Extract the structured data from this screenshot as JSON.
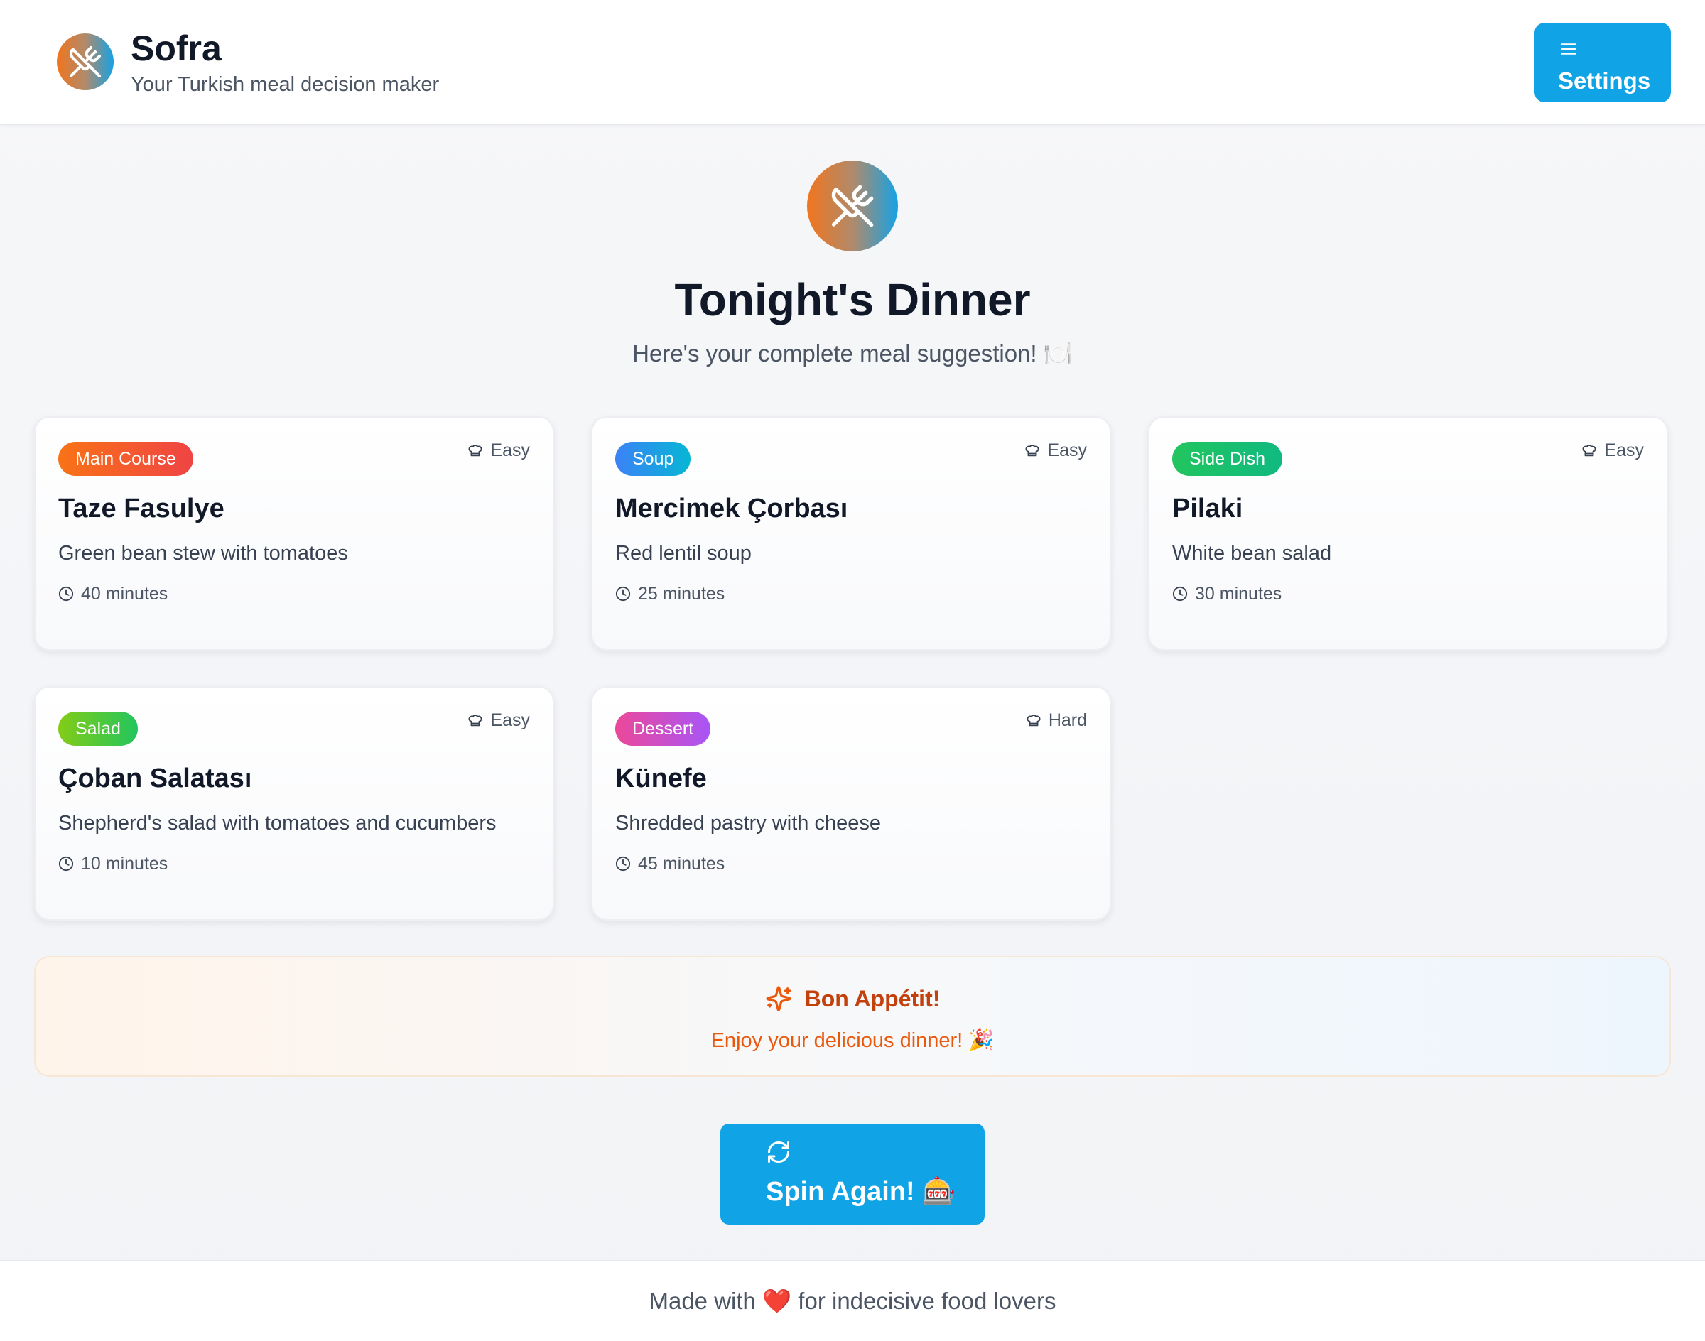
{
  "header": {
    "title": "Sofra",
    "subtitle": "Your Turkish meal decision maker",
    "settings_label": "Settings"
  },
  "hero": {
    "title": "Tonight's Dinner",
    "subtitle": "Here's your complete meal suggestion! 🍽️"
  },
  "meals": [
    {
      "category": "Main Course",
      "category_color": "linear-gradient(90deg,#f97316,#ef4444)",
      "difficulty": "Easy",
      "name": "Taze Fasulye",
      "description": "Green bean stew with tomatoes",
      "time": "40 minutes"
    },
    {
      "category": "Soup",
      "category_color": "linear-gradient(90deg,#3b82f6,#06b6d4)",
      "difficulty": "Easy",
      "name": "Mercimek Çorbası",
      "description": "Red lentil soup",
      "time": "25 minutes"
    },
    {
      "category": "Side Dish",
      "category_color": "linear-gradient(90deg,#22c55e,#10b981)",
      "difficulty": "Easy",
      "name": "Pilaki",
      "description": "White bean salad",
      "time": "30 minutes"
    },
    {
      "category": "Salad",
      "category_color": "linear-gradient(90deg,#84cc16,#22c55e)",
      "difficulty": "Easy",
      "name": "Çoban Salatası",
      "description": "Shepherd's salad with tomatoes and cucumbers",
      "time": "10 minutes"
    },
    {
      "category": "Dessert",
      "category_color": "linear-gradient(90deg,#ec4899,#a855f7)",
      "difficulty": "Hard",
      "name": "Künefe",
      "description": "Shredded pastry with cheese",
      "time": "45 minutes"
    }
  ],
  "banner": {
    "title": "Bon Appétit!",
    "text": "Enjoy your delicious dinner! 🎉"
  },
  "spin": {
    "label": "Spin Again! 🎰"
  },
  "footer": {
    "text": "Made with ❤️ for indecisive food lovers"
  },
  "icons": {
    "logo": "utensils-crossed-icon",
    "settings": "menu-icon",
    "difficulty": "chef-hat-icon",
    "time": "clock-icon",
    "banner": "sparkles-icon",
    "spin": "refresh-icon"
  },
  "colors": {
    "accent": "#10a3e6",
    "banner_title": "#c2410c",
    "banner_text": "#ea580c"
  }
}
